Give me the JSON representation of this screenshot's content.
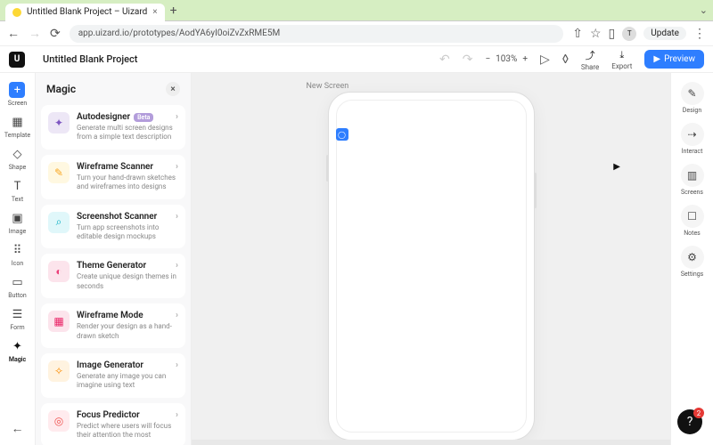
{
  "browser": {
    "tab_title": "Untitled Blank Project – Uizard",
    "url": "app.uizard.io/prototypes/AodYA6yI0oiZvZxRME5M",
    "update_label": "Update",
    "avatar_letter": "T"
  },
  "header": {
    "project_title": "Untitled Blank Project",
    "zoom": "103%",
    "share": "Share",
    "export": "Export",
    "preview": "Preview"
  },
  "left_sidebar": {
    "items": [
      {
        "label": "Screen",
        "icon": "+",
        "variant": "plus"
      },
      {
        "label": "Template",
        "icon": "▦"
      },
      {
        "label": "Shape",
        "icon": "◇"
      },
      {
        "label": "Text",
        "icon": "T"
      },
      {
        "label": "Image",
        "icon": "▣"
      },
      {
        "label": "Icon",
        "icon": "⠿"
      },
      {
        "label": "Button",
        "icon": "▭"
      },
      {
        "label": "Form",
        "icon": "☰"
      },
      {
        "label": "Magic",
        "icon": "✦",
        "active": true
      }
    ]
  },
  "magic_panel": {
    "title": "Magic",
    "items": [
      {
        "title": "Autodesigner",
        "badge": "Beta",
        "desc": "Generate multi screen designs from a simple text description",
        "icon_cls": "i-purp",
        "icon": "✦"
      },
      {
        "title": "Wireframe Scanner",
        "desc": "Turn your hand-drawn sketches and wireframes into designs",
        "icon_cls": "i-yell",
        "icon": "✎"
      },
      {
        "title": "Screenshot Scanner",
        "desc": "Turn app screenshots into editable design mockups",
        "icon_cls": "i-cyan",
        "icon": "⌕"
      },
      {
        "title": "Theme Generator",
        "desc": "Create unique design themes in seconds",
        "icon_cls": "i-pink",
        "icon": "◐"
      },
      {
        "title": "Wireframe Mode",
        "desc": "Render your design as a hand-drawn sketch",
        "icon_cls": "i-mag",
        "icon": "▦"
      },
      {
        "title": "Image Generator",
        "desc": "Generate any image you can imagine using text",
        "icon_cls": "i-orng",
        "icon": "✧"
      },
      {
        "title": "Focus Predictor",
        "desc": "Predict where users will focus their attention the most",
        "icon_cls": "i-red",
        "icon": "◎"
      }
    ]
  },
  "canvas": {
    "screen_label": "New Screen"
  },
  "right_sidebar": {
    "items": [
      {
        "label": "Design",
        "icon": "✎"
      },
      {
        "label": "Interact",
        "icon": "⇢"
      },
      {
        "label": "Screens",
        "icon": "▥"
      },
      {
        "label": "Notes",
        "icon": "☐"
      },
      {
        "label": "Settings",
        "icon": "⚙"
      }
    ]
  },
  "help_badge": "2"
}
